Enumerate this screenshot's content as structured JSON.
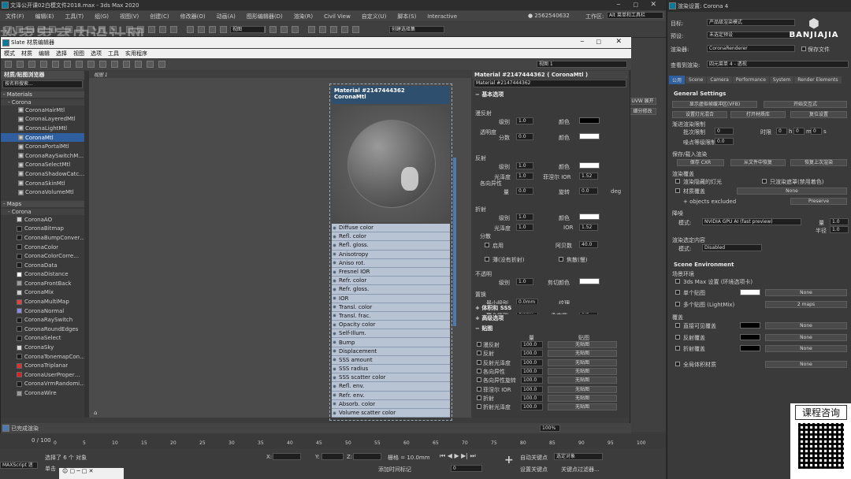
{
  "max": {
    "title": "文泽公开课02白模文件2018.max - 3ds Max 2020",
    "menus": [
      "文件(F)",
      "编辑(E)",
      "工具(T)",
      "组(G)",
      "视图(V)",
      "创建(C)",
      "修改器(O)",
      "动画(A)",
      "图形编辑器(D)",
      "渲染(R)",
      "Civil View",
      "自定义(U)",
      "脚本(S)",
      "Interactive"
    ],
    "user": "2562540632",
    "workspace_label": "工作区:",
    "workspace_value": "Alt 菜单和工具栏",
    "view_dd": "视图",
    "sel_dd": "创建选择集"
  },
  "watermark": "扮家家室内设计网",
  "logo_text": "BANJIAJIA",
  "side_btns": [
    "UVW 展开",
    "细分修改"
  ],
  "slate": {
    "title": "Slate 材质编辑器",
    "menus": [
      "模式",
      "材质",
      "编辑",
      "选择",
      "视图",
      "选项",
      "工具",
      "实用程序"
    ],
    "view_label": "视图 1",
    "browser_title": "材质/贴图浏览器",
    "search": "按名称搜索...",
    "materials_head": "- Materials",
    "corona_head": "- Corona",
    "materials": [
      "CoronaHairMtl",
      "CoronaLayeredMtl",
      "CoronaLightMtl",
      "CoronaMtl",
      "CoronaPortalMtl",
      "CoronaRaySwitchM…",
      "CoronaSelectMtl",
      "CoronaShadowCatc…",
      "CoronaSkinMtl",
      "CoronaVolumeMtl"
    ],
    "maps_head": "- Maps",
    "maps_corona_head": "- Corona",
    "maps": [
      {
        "n": "CoronaAO",
        "c": "#cfcfcf"
      },
      {
        "n": "CoronaBitmap",
        "c": "#1a1a1a"
      },
      {
        "n": "CoronaBumpConver…",
        "c": "#1a1a1a"
      },
      {
        "n": "CoronaColor",
        "c": "#1a1a1a"
      },
      {
        "n": "CoronaColorCorre…",
        "c": "#1a1a1a"
      },
      {
        "n": "CoronaData",
        "c": "#1a1a1a"
      },
      {
        "n": "CoronaDistance",
        "c": "#ffffff"
      },
      {
        "n": "CoronaFrontBack",
        "c": "#9a9a9a"
      },
      {
        "n": "CoronaMix",
        "c": "#cfcfcf"
      },
      {
        "n": "CoronaMultiMap",
        "c": "#e04040"
      },
      {
        "n": "CoronaNormal",
        "c": "#8a8ae0"
      },
      {
        "n": "CoronaRaySwitch",
        "c": "#1a1a1a"
      },
      {
        "n": "CoronaRoundEdges",
        "c": "#1a1a1a"
      },
      {
        "n": "CoronaSelect",
        "c": "#1a1a1a"
      },
      {
        "n": "CoronaSky",
        "c": "#d8d8d8"
      },
      {
        "n": "CoronaTonemapCon…",
        "c": "#1a1a1a"
      },
      {
        "n": "CoronaTriplanar",
        "c": "#e03030"
      },
      {
        "n": "CoronaUserProper…",
        "c": "#e02020"
      },
      {
        "n": "CoronaVrmRandomi…",
        "c": "#1a1a1a"
      },
      {
        "n": "CoronaWire",
        "c": "#9a9a9a"
      }
    ],
    "tab": "视图 1",
    "node": {
      "title": "Material #2147444362",
      "subtitle": "CoronaMtl",
      "slots": [
        "Diffuse color",
        "Refl. color",
        "Refl. gloss.",
        "Anisotropy",
        "Aniso rot.",
        "Fresnel IOR",
        "Refr. color",
        "Refr. gloss.",
        "IOR",
        "Transl. color",
        "Transl. frac.",
        "Opacity color",
        "Self-Illum.",
        "Bump",
        "Displacement",
        "SSS amount",
        "SSS radius",
        "SSS scatter color",
        "Refl. env.",
        "Refr. env.",
        "Absorb. color",
        "Volume scatter color"
      ]
    },
    "status": "已完成渲染",
    "zoom": "100%",
    "param": {
      "header": "Material #2147444362 ( CoronaMtl )",
      "name": "Material #2147444362",
      "basic": "基本选项",
      "diffuse": "漫反射",
      "level": "级别",
      "color": "颜色",
      "translucency": "透明度",
      "fraction": "分数",
      "reflection": "反射",
      "gloss": "光泽度",
      "fresnel": "菲涅尔 IOR",
      "aniso": "各向异性",
      "amount": "量",
      "rotation": "旋转",
      "deg": "deg",
      "refraction": "折射",
      "ior": "IOR",
      "dispersion": "分散",
      "enable": "启用",
      "abbe": "阿贝数",
      "thin": "薄(没有折射)",
      "caustics": "焦散(慢)",
      "opacity": "不透明",
      "clip": "剪切",
      "displacement": "置换",
      "min": "最小级别",
      "max": "最大级别",
      "texture": "纹理",
      "water": "水平面",
      "v1": "1.0",
      "v0": "0.0",
      "v152": "1.52",
      "v00d": "0.0",
      "v01": "0.01",
      "v0mm": "0.0mm",
      "v1mm": "1.0cm",
      "v05": "0.5",
      "abbe_val": "40.0",
      "volume": "体积和 SSS",
      "advanced": "高级选项",
      "maps": "贴图",
      "map_amount": "量",
      "map_col": "贴图",
      "map_rows": [
        "漫反射",
        "反射",
        "反射光泽度",
        "各向异性",
        "各向异性旋转",
        "菲涅尔 IOR",
        "折射",
        "折射光泽度"
      ],
      "map_val": "100.0",
      "no_map": "无贴图"
    }
  },
  "render": {
    "title": "渲染设置: Corona 4",
    "target_label": "目标:",
    "target": "产品级渲染模式",
    "preset_label": "预设:",
    "preset": "未选定预设",
    "renderer_label": "渲染器:",
    "renderer": "CoronaRenderer",
    "save_file": "保存文件",
    "view_label": "查看到渲染:",
    "view": "四元菜单 4 - 透视",
    "tabs": [
      "公用",
      "Scene",
      "Camera",
      "Performance",
      "System",
      "Render Elements"
    ],
    "general": "General Settings",
    "vfb": "显示虚拟帧缓冲区(VFB)",
    "interactive": "开始交互式",
    "light_mix": "设置灯光混合",
    "open_lib": "打开材质库",
    "reset": "复位设置",
    "limits": "渐进渲染限制",
    "passes": "批次限制",
    "passes_v": "0",
    "time": "时限",
    "h": "h",
    "m": "m",
    "s": "s",
    "zero": "0",
    "noise": "噪点等级限制",
    "noise_v": "0.0",
    "save_load": "保存/载入渲染",
    "save_cxr": "保存 CXR",
    "from_file": "从文件中恢复",
    "resume": "恢复上次渲染",
    "override": "渲染覆盖",
    "hidden": "渲染隐藏的灯光",
    "only_mask": "只渲染遮罩(禁用着色)",
    "mtl_override": "材质覆盖",
    "none": "None",
    "excluded": "+ objects excluded",
    "preserve": "Preserve",
    "denoise": "降噪",
    "mode": "模式:",
    "denoise_v": "NVIDIA GPU AI (fast preview)",
    "amount": "量",
    "amount_v": "1.0",
    "radius": "半径",
    "radius_v": "1.0",
    "region": "渲染选定内容",
    "region_mode": "模式:",
    "region_v": "Disabled",
    "env": "Scene Environment",
    "env_label": "场景环境",
    "use_max": "3ds Max 设置 (环境选项卡)",
    "single": "单个贴图",
    "multi": "多个贴图 (LightMix)",
    "maps2": "2 maps",
    "overrides": "覆盖",
    "direct": "直接可见覆盖",
    "refl": "反射覆盖",
    "refr": "折射覆盖",
    "global": "全局体积材质"
  },
  "timeline": {
    "frame": "0 / 100",
    "ticks": [
      "0",
      "5",
      "10",
      "15",
      "20",
      "25",
      "30",
      "35",
      "40",
      "45",
      "50",
      "55",
      "60",
      "65",
      "70",
      "75",
      "80",
      "85",
      "90",
      "95",
      "100"
    ]
  },
  "bottom": {
    "script": "MAXScript 迷",
    "selected": "选择了 6 个 对象",
    "click": "单击",
    "grid": "栅格 = 10.0mm",
    "add_time": "添加时间标记",
    "auto_key": "自动关键点",
    "set_key": "设置关键点",
    "sel_obj": "选定对象",
    "key_filter": "关键点过滤器...",
    "x": "X:",
    "y": "Y:",
    "z": "Z:",
    "frame_v": "0"
  },
  "qr": {
    "label": "课程咨询"
  }
}
